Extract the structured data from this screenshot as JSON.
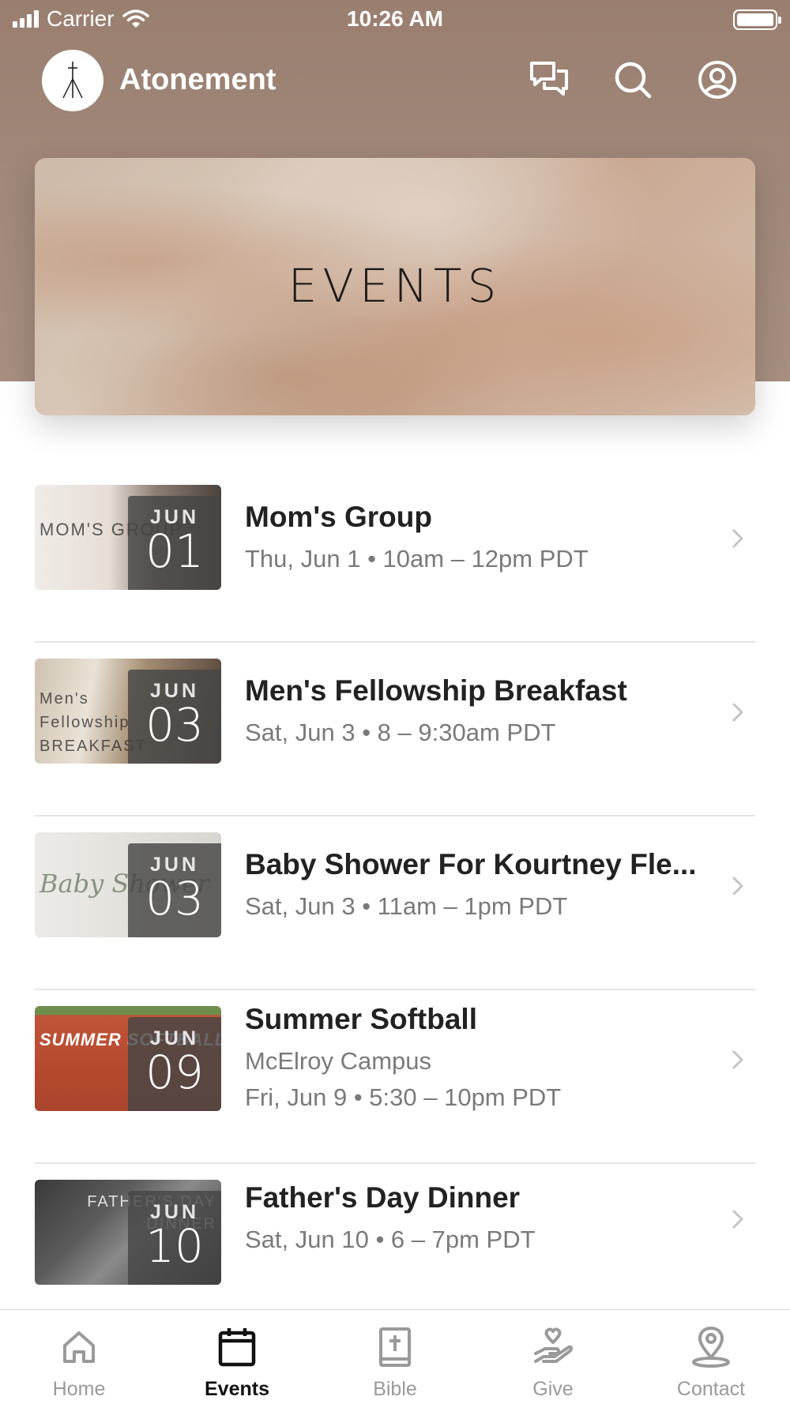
{
  "status_bar": {
    "carrier": "Carrier",
    "time": "10:26 AM"
  },
  "header": {
    "title": "Atonement",
    "icons": [
      "chat-icon",
      "search-icon",
      "account-icon"
    ]
  },
  "banner": {
    "title": "EVENTS"
  },
  "events": [
    {
      "title": "Mom's Group",
      "lines": [
        "Thu, Jun 1 • 10am – 12pm PDT"
      ],
      "month": "JUN",
      "day": "01",
      "thumb_text": "MOM'S GROUP"
    },
    {
      "title": "Men's Fellowship Breakfast",
      "lines": [
        "Sat, Jun 3 • 8 – 9:30am PDT"
      ],
      "month": "JUN",
      "day": "03",
      "thumb_text": "Men's Fellowship BREAKFAST"
    },
    {
      "title": "Baby Shower For Kourtney Fle...",
      "lines": [
        "Sat, Jun 3 • 11am – 1pm PDT"
      ],
      "month": "JUN",
      "day": "03",
      "thumb_text": "Baby Shower"
    },
    {
      "title": "Summer Softball",
      "lines": [
        "McElroy Campus",
        "Fri, Jun 9 • 5:30 – 10pm PDT"
      ],
      "month": "JUN",
      "day": "09",
      "thumb_text": "SUMMER SOFTBALL"
    },
    {
      "title": "Father's Day Dinner",
      "lines": [
        "Sat, Jun 10 • 6 – 7pm PDT"
      ],
      "month": "JUN",
      "day": "10",
      "thumb_text": "FATHER'S DAY DINNER"
    }
  ],
  "tabs": [
    {
      "label": "Home",
      "icon": "home-icon",
      "active": false
    },
    {
      "label": "Events",
      "icon": "calendar-icon",
      "active": true
    },
    {
      "label": "Bible",
      "icon": "bible-icon",
      "active": false
    },
    {
      "label": "Give",
      "icon": "give-icon",
      "active": false
    },
    {
      "label": "Contact",
      "icon": "location-pin-icon",
      "active": false
    }
  ],
  "colors": {
    "header_bg": "#9a7f70",
    "tab_active": "#111111",
    "tab_inactive": "#9a9a9a"
  }
}
